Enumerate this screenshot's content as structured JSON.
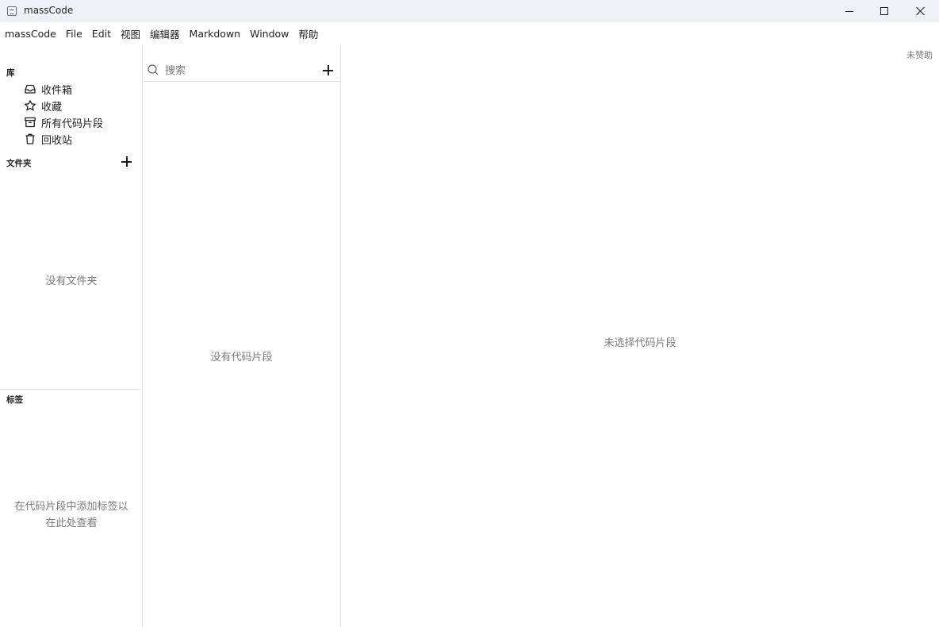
{
  "window": {
    "title": "massCode"
  },
  "menu": [
    {
      "label": "massCode"
    },
    {
      "label": "File"
    },
    {
      "label": "Edit"
    },
    {
      "label": "视图"
    },
    {
      "label": "编辑器"
    },
    {
      "label": "Markdown"
    },
    {
      "label": "Window"
    },
    {
      "label": "帮助"
    }
  ],
  "sidebar": {
    "library_title": "库",
    "library_items": [
      {
        "label": "收件箱",
        "icon": "inbox-icon"
      },
      {
        "label": "收藏",
        "icon": "star-icon"
      },
      {
        "label": "所有代码片段",
        "icon": "archive-icon"
      },
      {
        "label": "回收站",
        "icon": "trash-icon"
      }
    ],
    "folders_title": "文件夹",
    "folders_empty": "没有文件夹",
    "tags_title": "标签",
    "tags_empty_line1": "在代码片段中添加标签以",
    "tags_empty_line2": "在此处查看"
  },
  "snippets": {
    "search_placeholder": "搜索",
    "empty": "没有代码片段"
  },
  "editor": {
    "sponsor": "未赞助",
    "empty": "未选择代码片段"
  }
}
